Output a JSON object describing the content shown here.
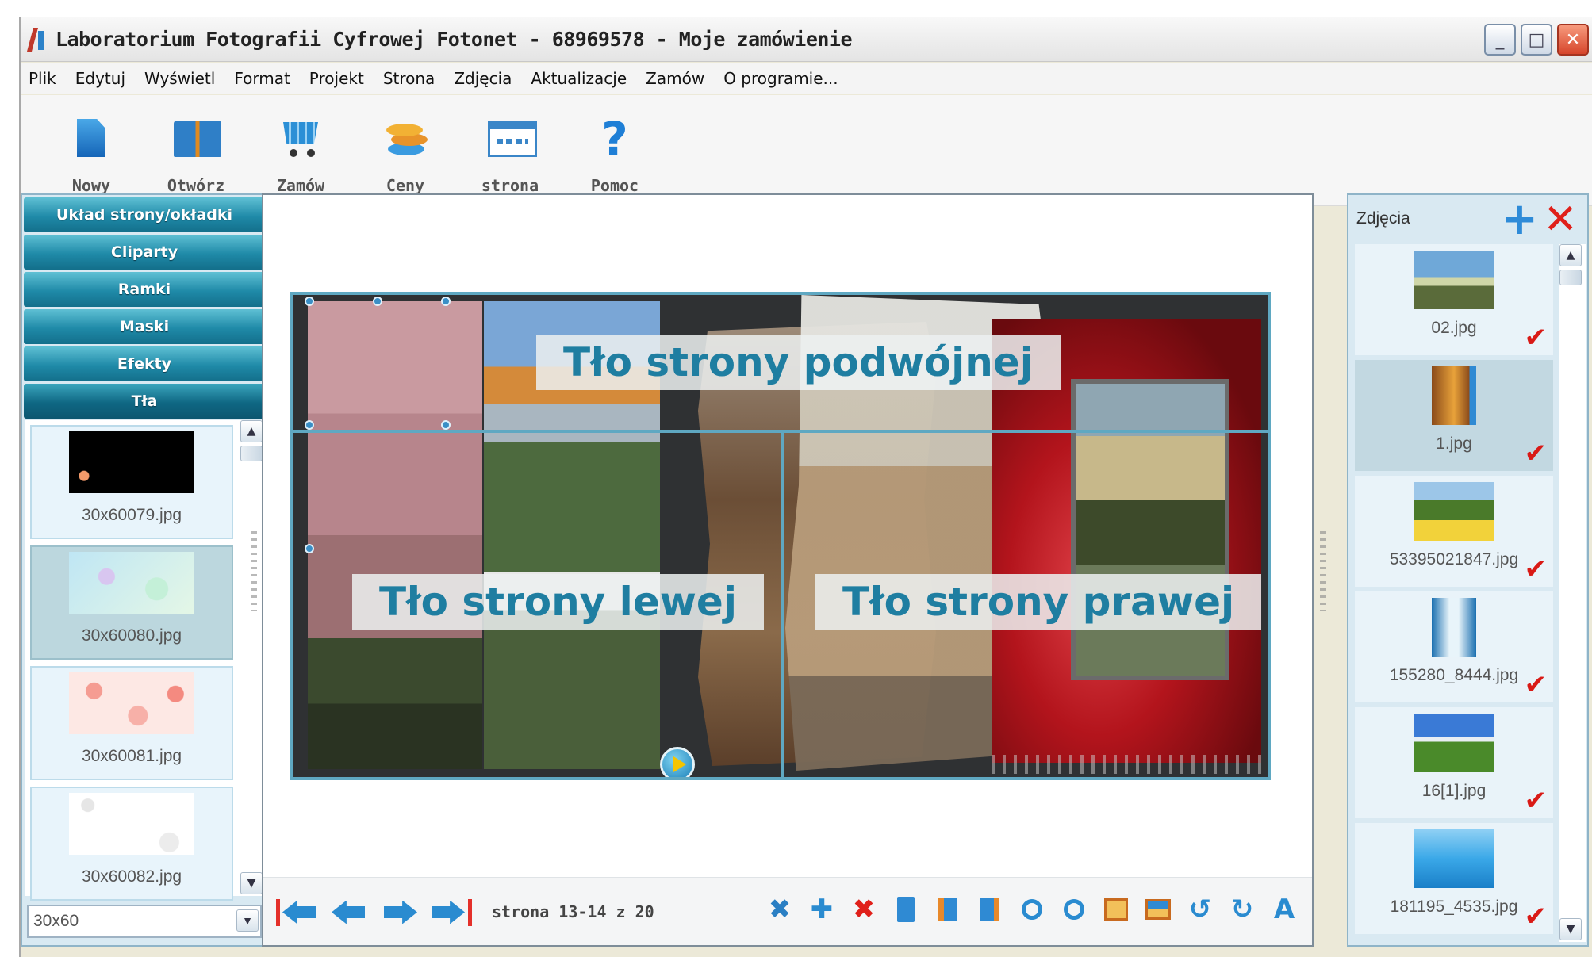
{
  "window": {
    "title": "Laboratorium Fotografii Cyfrowej Fotonet - 68969578 - Moje zamówienie",
    "buttons": {
      "minimize": "_",
      "maximize": "□",
      "close": "✕"
    }
  },
  "menu": [
    "Plik",
    "Edytuj",
    "Wyświetl",
    "Format",
    "Projekt",
    "Strona",
    "Zdjęcia",
    "Aktualizacje",
    "Zamów",
    "O programie..."
  ],
  "toolbar": [
    {
      "label": "Nowy",
      "icon": "new-document-icon"
    },
    {
      "label": "Otwórz",
      "icon": "open-book-icon"
    },
    {
      "label": "Zamów",
      "icon": "cart-icon"
    },
    {
      "label": "Ceny",
      "icon": "coins-icon"
    },
    {
      "label": "strona",
      "icon": "web-page-icon"
    },
    {
      "label": "Pomoc",
      "icon": "help-icon"
    }
  ],
  "left_panel": {
    "sections": [
      "Układ strony/okładki",
      "Cliparty",
      "Ramki",
      "Maski",
      "Efekty",
      "Tła"
    ],
    "active_section": "Tła",
    "backgrounds": [
      {
        "label": "30x60079.jpg",
        "colors": [
          "#000000",
          "#000000"
        ]
      },
      {
        "label": "30x60080.jpg",
        "colors": [
          "#bfe6f4",
          "#e4f7e6"
        ]
      },
      {
        "label": "30x60081.jpg",
        "colors": [
          "#fde0dc",
          "#f6b7b0"
        ]
      },
      {
        "label": "30x60082.jpg",
        "colors": [
          "#ffffff",
          "#f1f1f1"
        ]
      }
    ],
    "selected_background": "30x60080.jpg",
    "size_select": "30x60"
  },
  "canvas": {
    "labels": {
      "double": "Tło strony podwójnej",
      "left": "Tło strony lewej",
      "right": "Tło strony prawej"
    },
    "page_indicator": "strona 13-14 z 20"
  },
  "right_panel": {
    "title": "Zdjęcia",
    "add": "+",
    "remove": "✕",
    "photos": [
      {
        "label": "02.jpg",
        "colors": [
          "#6fa8d8",
          "#5a6b3a"
        ]
      },
      {
        "label": "1.jpg",
        "colors": [
          "#e8a23a",
          "#8a4a1a"
        ]
      },
      {
        "label": "53395021847.jpg",
        "colors": [
          "#7aa24a",
          "#f2d23a"
        ]
      },
      {
        "label": "155280_8444.jpg",
        "colors": [
          "#e8f4fa",
          "#1a8fd0"
        ]
      },
      {
        "label": "16[1].jpg",
        "colors": [
          "#3a7ad6",
          "#4a8a2a"
        ]
      },
      {
        "label": "181195_4535.jpg",
        "colors": [
          "#3aa8e8",
          "#8fd0f4"
        ]
      }
    ],
    "selected_photo": "1.jpg",
    "check": "✔"
  },
  "colors": {
    "accent_teal": "#1f8aa8",
    "arrow_blue": "#2a8bd0",
    "delete_red": "#e0201a"
  }
}
